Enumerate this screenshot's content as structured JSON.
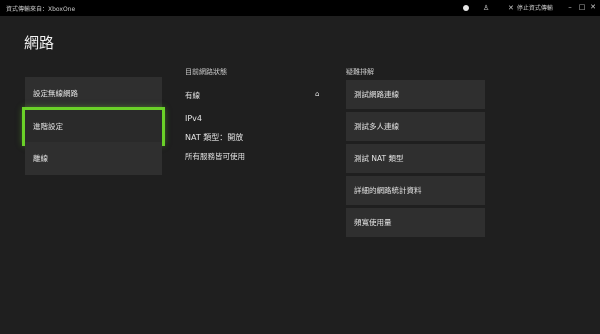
{
  "titlebar": {
    "title": "資式傳輸來自：XboxOne",
    "stop_label": "停止資式傳輸"
  },
  "page": {
    "title": "網路"
  },
  "nav": {
    "items": [
      {
        "label": "設定無線網路"
      },
      {
        "label": "進階設定"
      },
      {
        "label": "離線"
      }
    ]
  },
  "status": {
    "heading": "目前網路狀態",
    "connection": "有線",
    "protocol": "IPv4",
    "nat": "NAT 類型：開放",
    "services": "所有服務皆可使用"
  },
  "troubleshoot": {
    "heading": "疑難排解",
    "items": [
      {
        "label": "測試網路連線"
      },
      {
        "label": "測試多人連線"
      },
      {
        "label": "測試 NAT 類型"
      },
      {
        "label": "詳細的網路統計資料"
      },
      {
        "label": "頻寬使用量"
      }
    ]
  },
  "colors": {
    "background": "#1f1f1f",
    "tile": "#2f2f2f",
    "focus": "#6ad128",
    "titlebar": "#000000"
  }
}
